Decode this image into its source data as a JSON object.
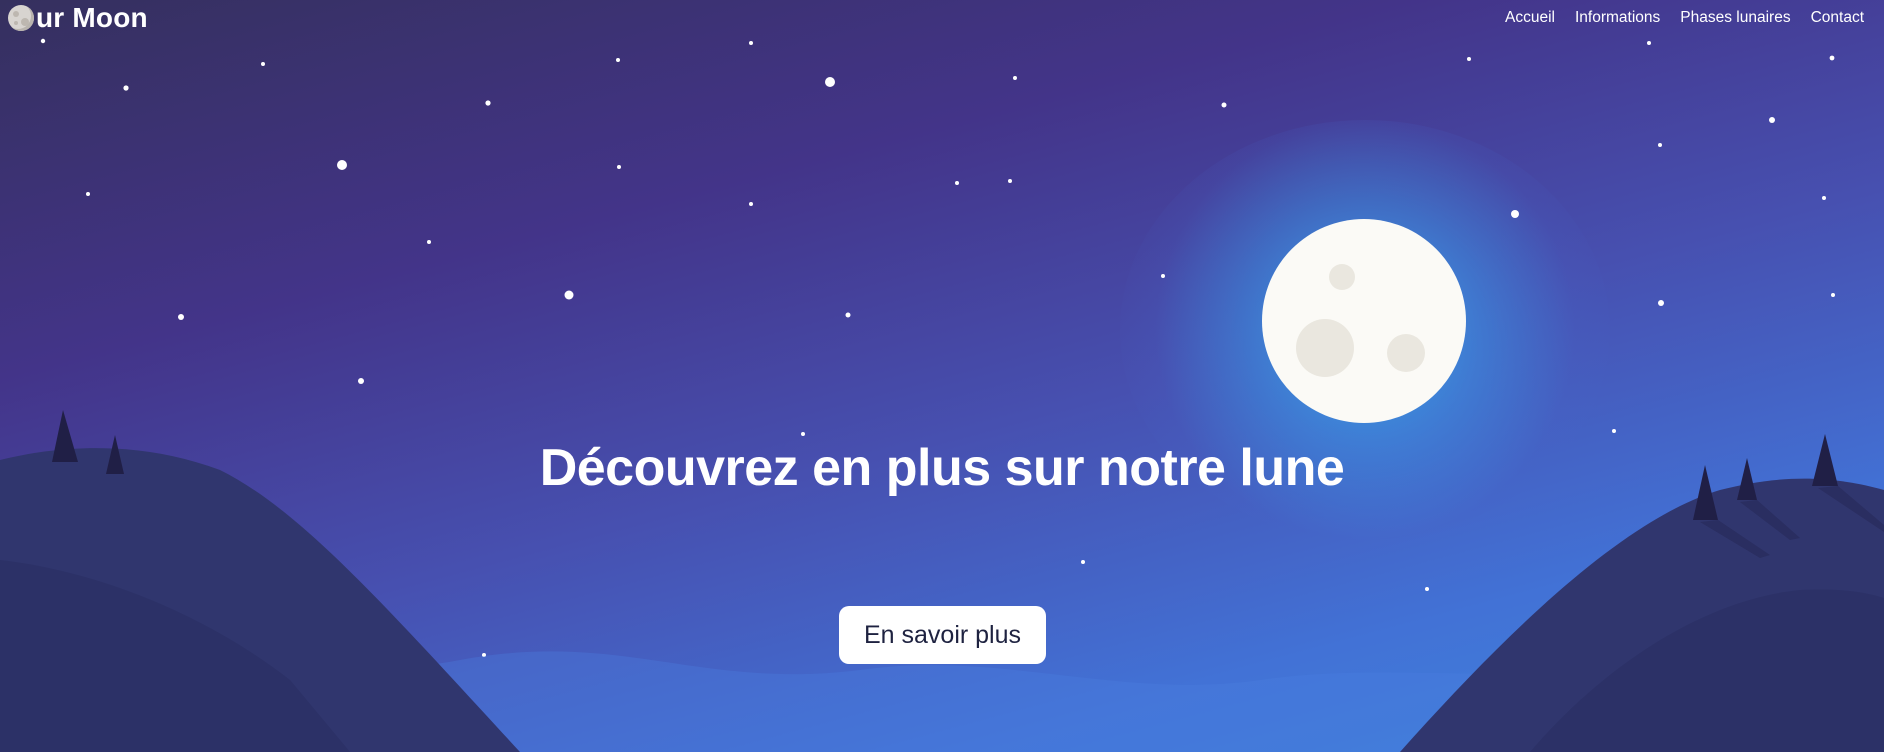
{
  "brand": {
    "name": "ur Moon",
    "icon": "moon-icon"
  },
  "nav": {
    "items": [
      {
        "label": "Accueil"
      },
      {
        "label": "Informations"
      },
      {
        "label": "Phases lunaires"
      },
      {
        "label": "Contact"
      }
    ]
  },
  "hero": {
    "headline": "Découvrez en plus sur notre lune",
    "cta_label": "En savoir plus"
  },
  "colors": {
    "sky_top": "#35305e",
    "sky_mid": "#433489",
    "sky_bottom": "#3d86dc",
    "moon": "#fbfaf6",
    "moon_glow": "#3aa8eb",
    "hills_dark": "#31366f",
    "trees": "#201f46",
    "button_bg": "#ffffff",
    "button_text": "#1e2240"
  }
}
